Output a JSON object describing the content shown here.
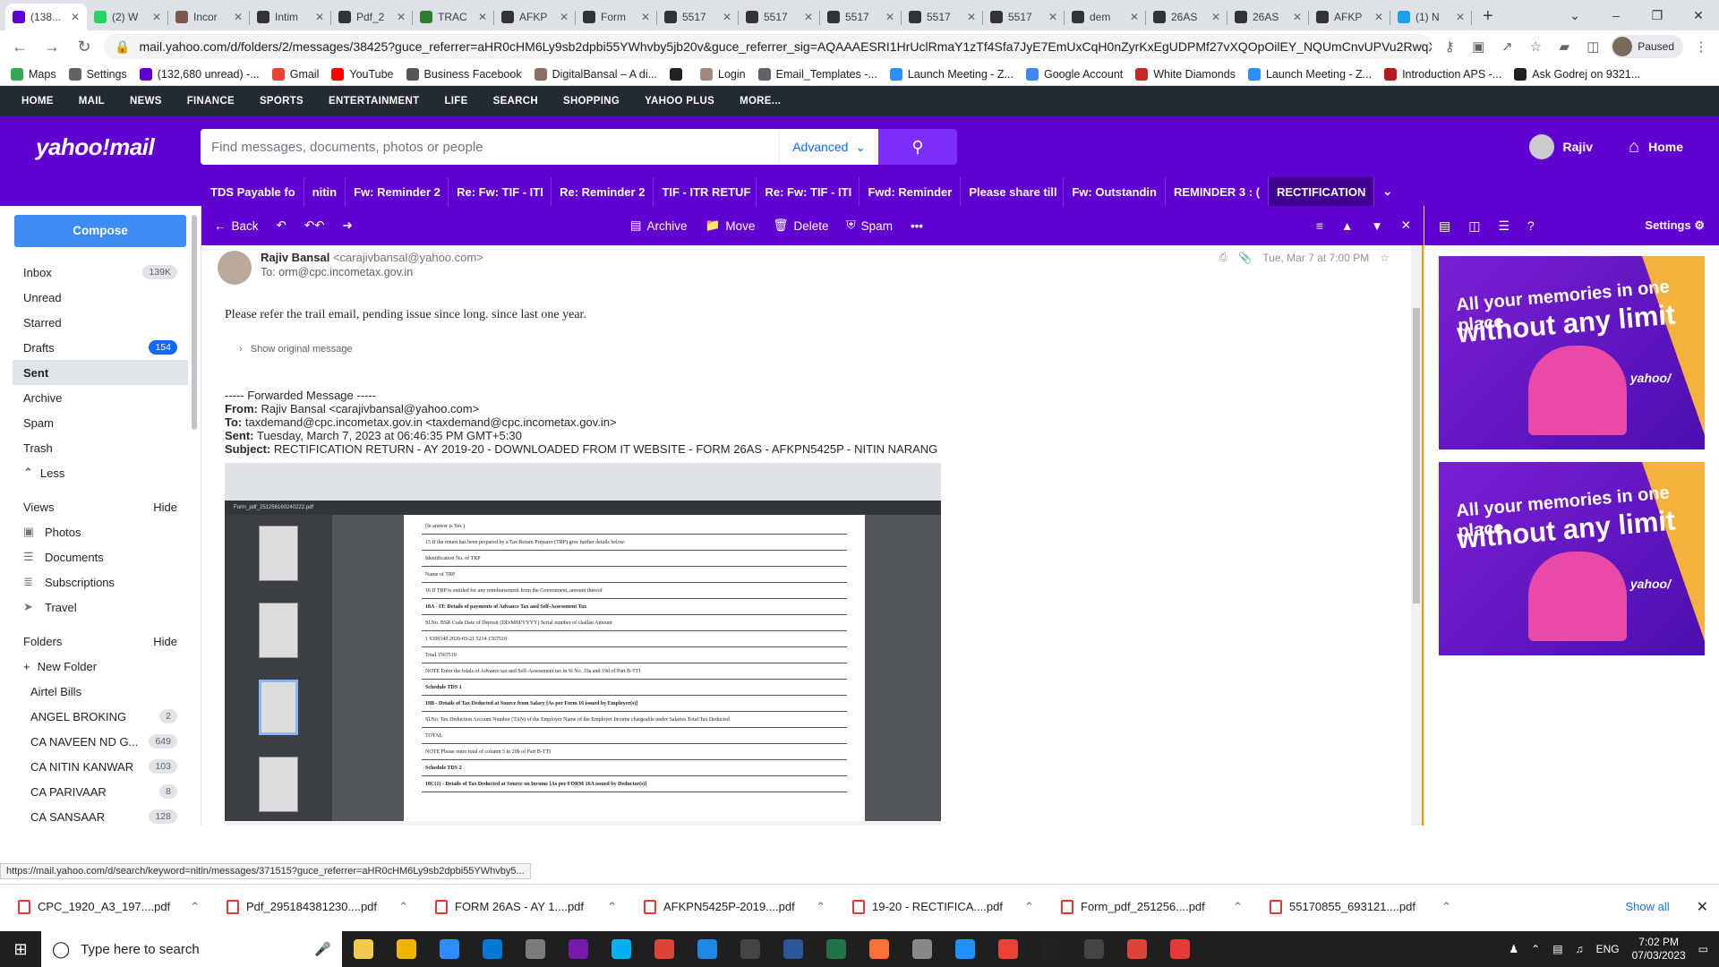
{
  "browser": {
    "tabs": [
      {
        "label": "(138...",
        "color": "#6001d2",
        "active": true
      },
      {
        "label": "(2) W",
        "color": "#25d366"
      },
      {
        "label": "Incor",
        "color": "#7a5a4a"
      },
      {
        "label": "Intim",
        "color": "#333333"
      },
      {
        "label": "Pdf_2",
        "color": "#333333"
      },
      {
        "label": "TRAC",
        "color": "#2e7d32"
      },
      {
        "label": "AFKP",
        "color": "#333333"
      },
      {
        "label": "Form",
        "color": "#333333"
      },
      {
        "label": "5517",
        "color": "#333333"
      },
      {
        "label": "5517",
        "color": "#333333"
      },
      {
        "label": "5517",
        "color": "#333333"
      },
      {
        "label": "5517",
        "color": "#333333"
      },
      {
        "label": "5517",
        "color": "#333333"
      },
      {
        "label": "dem",
        "color": "#333333"
      },
      {
        "label": "26AS",
        "color": "#333333"
      },
      {
        "label": "26AS",
        "color": "#333333"
      },
      {
        "label": "AFKP",
        "color": "#333333"
      },
      {
        "label": "(1) N",
        "color": "#1da1f2"
      }
    ],
    "url": "mail.yahoo.com/d/folders/2/messages/38425?guce_referrer=aHR0cHM6Ly9sb2dpbi55YWhvby5jb20v&guce_referrer_sig=AQAAAESRI1HrUclRmaY1zTf4Sfa7JyE7EmUxCqH0nZyrKxEgUDPMf27vXQOpOilEY_NQUmCnvUPVu2RwqXucwW...",
    "profile": "Paused",
    "bookmarks": [
      {
        "label": "Maps",
        "color": "#34a853"
      },
      {
        "label": "Settings",
        "color": "#5f6368"
      },
      {
        "label": "(132,680 unread) -...",
        "color": "#6001d2"
      },
      {
        "label": "Gmail",
        "color": "#ea4335"
      },
      {
        "label": "YouTube",
        "color": "#ff0000"
      },
      {
        "label": "Business Facebook",
        "color": "#555555"
      },
      {
        "label": "DigitalBansal – A di...",
        "color": "#8d6e63"
      },
      {
        "label": "",
        "color": "#222222"
      },
      {
        "label": "Login",
        "color": "#a1887f"
      },
      {
        "label": "Email_Templates -...",
        "color": "#5f6368"
      },
      {
        "label": "Launch Meeting - Z...",
        "color": "#2d8cff"
      },
      {
        "label": "Google Account",
        "color": "#4285f4"
      },
      {
        "label": "White Diamonds",
        "color": "#c62828"
      },
      {
        "label": "Launch Meeting - Z...",
        "color": "#2d8cff"
      },
      {
        "label": "Introduction APS -...",
        "color": "#b71c1c"
      },
      {
        "label": "Ask Godrej on 9321...",
        "color": "#222222"
      }
    ]
  },
  "ynav": [
    "HOME",
    "MAIL",
    "NEWS",
    "FINANCE",
    "SPORTS",
    "ENTERTAINMENT",
    "LIFE",
    "SEARCH",
    "SHOPPING",
    "YAHOO PLUS",
    "MORE..."
  ],
  "header": {
    "logo": "yahoo!mail",
    "search_placeholder": "Find messages, documents, photos or people",
    "advanced": "Advanced",
    "user": "Rajiv",
    "home": "Home"
  },
  "threadtabs": [
    "TDS Payable fo",
    "nitin",
    "Fw: Reminder 2",
    "Re: Fw: TIF - ITI",
    "Re: Reminder 2",
    "TIF - ITR RETUF",
    "Re: Fw: TIF - ITI",
    "Fwd: Reminder",
    "Please share till",
    "Fw: Outstandin",
    "REMINDER 3 : (",
    "RECTIFICATION"
  ],
  "sidebar": {
    "compose": "Compose",
    "folders": [
      {
        "label": "Inbox",
        "count": "139K"
      },
      {
        "label": "Unread",
        "count": ""
      },
      {
        "label": "Starred",
        "count": ""
      },
      {
        "label": "Drafts",
        "count": "154",
        "blue": true
      },
      {
        "label": "Sent",
        "count": "",
        "active": true
      },
      {
        "label": "Archive",
        "count": ""
      },
      {
        "label": "Spam",
        "count": ""
      },
      {
        "label": "Trash",
        "count": ""
      }
    ],
    "less": "Less",
    "views_title": "Views",
    "views_hide": "Hide",
    "views": [
      "Photos",
      "Documents",
      "Subscriptions",
      "Travel"
    ],
    "folders_title": "Folders",
    "folders_hide": "Hide",
    "new_folder": "New Folder",
    "user_folders": [
      {
        "label": "Airtel Bills",
        "count": ""
      },
      {
        "label": "ANGEL BROKING",
        "count": "2"
      },
      {
        "label": "CA NAVEEN ND G...",
        "count": "649"
      },
      {
        "label": "CA NITIN KANWAR",
        "count": "103"
      },
      {
        "label": "CA PARIVAAR",
        "count": "8"
      },
      {
        "label": "CA SANSAAR",
        "count": "128"
      }
    ]
  },
  "toolbar": {
    "back": "Back",
    "archive": "Archive",
    "move": "Move",
    "delete": "Delete",
    "spam": "Spam"
  },
  "message": {
    "sender": "Rajiv Bansal",
    "sender_email": "<carajivbansal@yahoo.com>",
    "to": "To: orm@cpc.incometax.gov.in",
    "date": "Tue, Mar 7 at 7:00 PM",
    "body": "Please refer the trail email, pending issue since long. since last one year.",
    "show_original": "Show original message",
    "fwd_header": "----- Forwarded Message -----",
    "fwd_from_label": "From:",
    "fwd_from": "Rajiv Bansal <carajivbansal@yahoo.com>",
    "fwd_to_label": "To:",
    "fwd_to": "taxdemand@cpc.incometax.gov.in <taxdemand@cpc.incometax.gov.in>",
    "fwd_sent_label": "Sent:",
    "fwd_sent": "Tuesday, March 7, 2023 at 06:46:35 PM GMT+5:30",
    "fwd_subject_label": "Subject:",
    "fwd_subject": "RECTIFICATION RETURN - AY 2019-20 - DOWNLOADED FROM IT WEBSITE - FORM 26AS - AFKPN5425P - NITIN NARANG"
  },
  "embedded": {
    "pdf_title": "Form_pdf_251256160240222.pdf",
    "lines": [
      "(Ie answer is Yes )",
      "15   If the return has been prepared by a Tax Return Preparer (TRP) give further details below:",
      "Identification No. of TRP",
      "Name of TRP",
      "16   If TRP is entitled for any reimbursement from the Government, amount thereof",
      "18A - IT: Details of payments of Advance Tax and Self-Assessment Tax",
      "Sl.No.   BSR Code   Date of Deposit (DD/MM/YYYY)   Serial number of challan   Amount",
      "1   6390340   2020-03-21   5214   1567510",
      "Total   1567510",
      "NOTE   Enter the totals of Advance tax and Self-Assessment tax in Sl No. 19a and 19d of Part B-TTI",
      "Schedule TDS 1",
      "18B - Details of Tax Deducted at Source from Salary [As per Form 16 issued by Employer(s)]",
      "Sl.No.   Tax Deduction Account Number (TAN) of the Employer   Name of the Employer   Income chargeable under Salaries   Total Tax Deducted",
      "TOTAL",
      "NOTE   Please enter total of column 5 in 20b of Part B-TTI",
      "Schedule TDS 2",
      "18C(1) - Details of Tax Deducted at Source on Income [As per FORM 16A issued by Deductor(s)]"
    ]
  },
  "ad": {
    "line1": "All your memories in one place",
    "line2": "without any limit",
    "brand": "yahoo/"
  },
  "right": {
    "settings": "Settings"
  },
  "status_url": "https://mail.yahoo.com/d/search/keyword=nitin/messages/371515?guce_referrer=aHR0cHM6Ly9sb2dpbi55YWhvby5...",
  "downloads": [
    "CPC_1920_A3_197....pdf",
    "Pdf_295184381230....pdf",
    "FORM 26AS - AY 1....pdf",
    "AFKPN5425P-2019....pdf",
    "19-20 - RECTIFICA....pdf",
    "Form_pdf_251256....pdf",
    "55170855_693121....pdf"
  ],
  "downloads_showall": "Show all",
  "taskbar": {
    "search": "Type here to search",
    "lang": "ENG",
    "time": "7:02 PM",
    "date": "07/03/2023",
    "apps": [
      "#f2c94c",
      "#f0b400",
      "#2d8cff",
      "#0078d4",
      "#7b7b7b",
      "#7719aa",
      "#00aff0",
      "#db4437",
      "#1e88e5",
      "#444444",
      "#2b579a",
      "#217346",
      "#ff7139",
      "#888888",
      "#1e90ff",
      "#ea4335",
      "#222222",
      "#444444",
      "#db4437",
      "#e53935"
    ]
  }
}
